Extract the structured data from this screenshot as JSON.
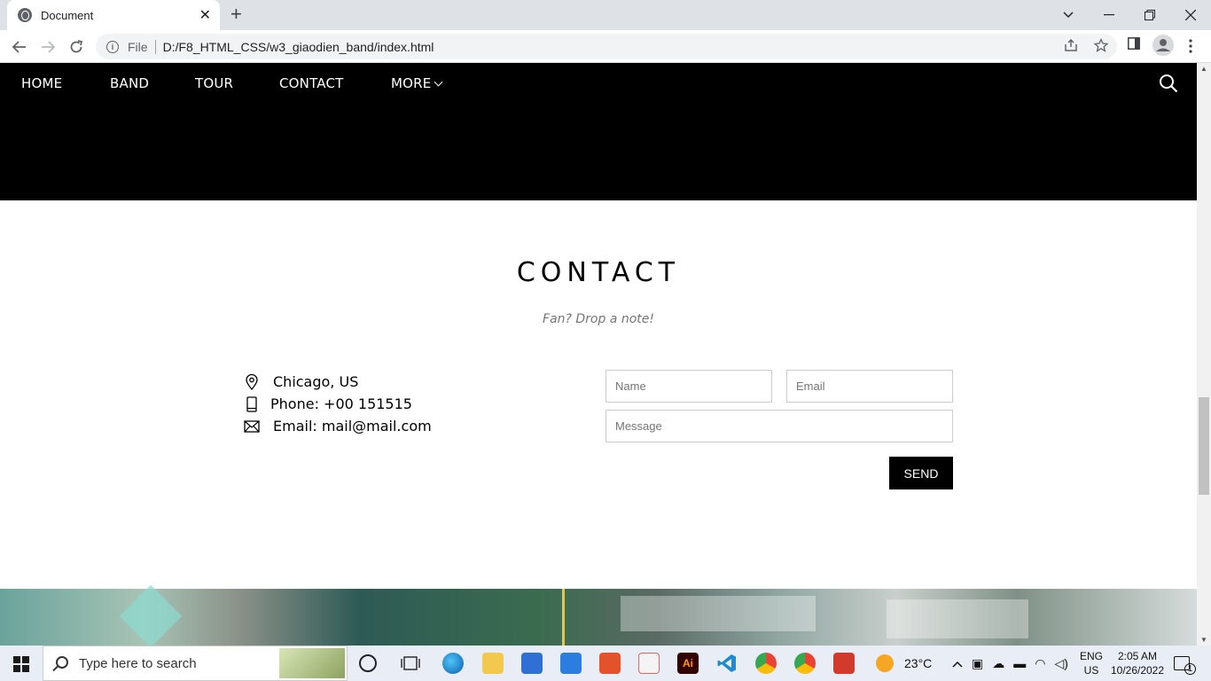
{
  "browser": {
    "tab_title": "Document",
    "tab_close": "✕",
    "new_tab": "+",
    "address_prefix": "File",
    "url": "D:/F8_HTML_CSS/w3_giaodien_band/index.html"
  },
  "nav": {
    "items": [
      "HOME",
      "BAND",
      "TOUR",
      "CONTACT",
      "MORE"
    ]
  },
  "contact": {
    "title": "CONTACT",
    "subtitle": "Fan? Drop a note!",
    "location": "Chicago, US",
    "phone": "Phone: +00 151515",
    "email": "Email: mail@mail.com",
    "form": {
      "name_placeholder": "Name",
      "email_placeholder": "Email",
      "message_placeholder": "Message",
      "send_label": "SEND"
    }
  },
  "taskbar": {
    "search_placeholder": "Type here to search",
    "weather": "23°C",
    "lang_top": "ENG",
    "lang_bottom": "US",
    "time": "2:05 AM",
    "date": "10/26/2022",
    "notifications": "1"
  },
  "colors": {
    "nav_bg": "#000000",
    "accent": "#000000",
    "subtitle": "#757575"
  }
}
